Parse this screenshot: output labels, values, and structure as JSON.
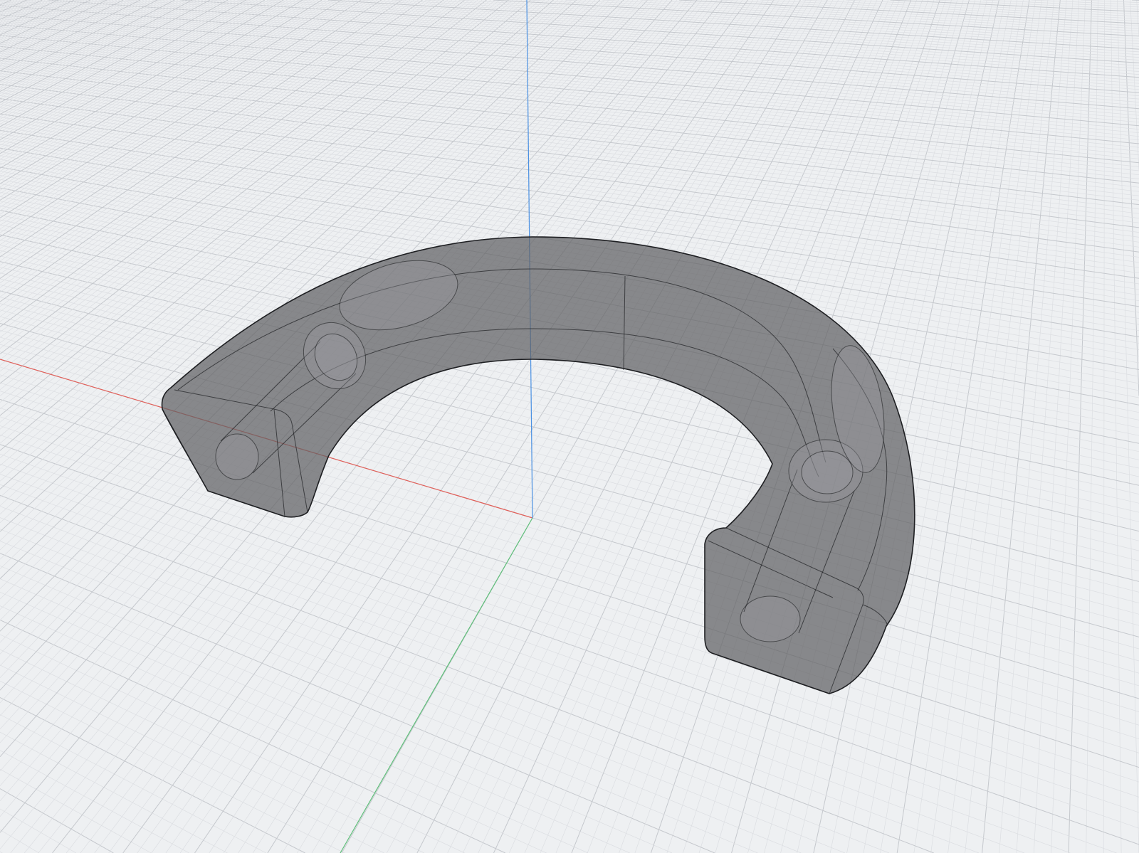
{
  "viewport": {
    "background_color": "#eef0f2",
    "grid_minor_color": "#dcdee2",
    "grid_major_color": "#c5c8cd",
    "axes": {
      "x_axis_color": "#e0605a",
      "y_axis_color": "#5fbf7a",
      "z_axis_color": "#4a90e2"
    },
    "model": {
      "name": "",
      "shape": "horseshoe-bracket",
      "render_mode": "x-ray",
      "body_color": "#5f6063",
      "edge_color": "#1e1f22"
    }
  }
}
